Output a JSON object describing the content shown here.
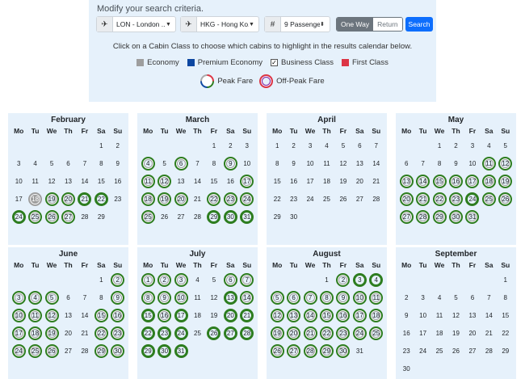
{
  "search": {
    "title": "Modify your search criteria.",
    "origin": "LON - London ...",
    "destination": "HKG - Hong Ko...",
    "passengers": "9 Passenger",
    "passenger_prefix": "#",
    "one_way": "One Way",
    "return": "Return",
    "search_button": "Search"
  },
  "instruction": "Click on a Cabin Class to choose which cabins to highlight in the results calendar below.",
  "cabins": [
    {
      "label": "Economy",
      "color": "#9e9e9e"
    },
    {
      "label": "Premium Economy",
      "color": "#0d47a1"
    },
    {
      "label": "Business Class",
      "color": "#2d7d1f"
    },
    {
      "label": "First Class",
      "color": "#dc3545"
    }
  ],
  "fares": {
    "peak": "Peak Fare",
    "off_peak": "Off-Peak Fare"
  },
  "weekdays": [
    "Mo",
    "Tu",
    "We",
    "Th",
    "Fr",
    "Sa",
    "Su"
  ],
  "months": [
    {
      "name": "February",
      "start": 5,
      "days": 29,
      "b": [
        19,
        20,
        25,
        26,
        27
      ],
      "p": [
        21,
        22,
        24
      ],
      "g": [
        18
      ]
    },
    {
      "name": "March",
      "start": 4,
      "days": 31,
      "b": [
        4,
        6,
        9,
        11,
        12,
        17,
        18,
        19,
        20,
        22,
        23,
        24,
        25
      ],
      "p": [
        29,
        30,
        31
      ],
      "g": []
    },
    {
      "name": "April",
      "start": 0,
      "days": 30,
      "b": [],
      "p": [],
      "g": []
    },
    {
      "name": "May",
      "start": 2,
      "days": 31,
      "b": [
        11,
        12,
        13,
        14,
        15,
        16,
        17,
        18,
        19,
        20,
        21,
        22,
        23,
        25,
        26,
        27,
        28,
        29,
        30,
        31
      ],
      "p": [
        24
      ],
      "g": []
    },
    {
      "name": "June",
      "start": 5,
      "days": 30,
      "b": [
        2,
        3,
        4,
        5,
        9,
        10,
        11,
        12,
        15,
        16,
        17,
        18,
        19,
        22,
        23,
        24,
        25,
        26,
        29,
        30
      ],
      "p": [],
      "g": []
    },
    {
      "name": "July",
      "start": 0,
      "days": 31,
      "b": [
        1,
        2,
        3,
        6,
        7,
        8,
        9,
        10,
        14,
        16
      ],
      "p": [
        13,
        15,
        17,
        20,
        21,
        22,
        23,
        24,
        26,
        27,
        28,
        29,
        30,
        31
      ],
      "g": []
    },
    {
      "name": "August",
      "start": 3,
      "days": 31,
      "b": [
        2,
        5,
        6,
        7,
        8,
        9,
        10,
        11,
        12,
        13,
        14,
        15,
        16,
        17,
        18,
        19,
        20,
        21,
        22,
        23,
        24,
        25,
        26,
        27,
        28,
        29,
        30
      ],
      "p": [
        3,
        4
      ],
      "g": []
    },
    {
      "name": "September",
      "start": 6,
      "days": 30,
      "b": [],
      "p": [],
      "g": []
    }
  ]
}
